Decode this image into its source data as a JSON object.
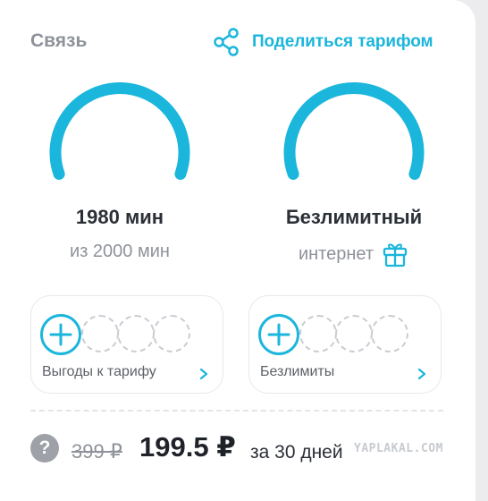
{
  "header": {
    "title": "Связь",
    "share_label": "Поделиться тарифом"
  },
  "gauges": [
    {
      "main": "1980 мин",
      "sub": "из 2000 мин",
      "remaining_fraction": 0.99
    },
    {
      "main": "Безлимитный",
      "sub": "интернет",
      "remaining_fraction": 1.0
    }
  ],
  "addons": [
    {
      "label": "Выгоды к тарифу",
      "empty_slots": 3
    },
    {
      "label": "Безлимиты",
      "empty_slots": 3
    }
  ],
  "price": {
    "old": "399 ₽",
    "new": "199.5 ₽",
    "period": "за 30 дней"
  },
  "watermark": "YAPLAKAL.COM",
  "colors": {
    "accent": "#1bb6dc",
    "muted_text": "#8e9299",
    "primary_text": "#2b2f36"
  },
  "icons": {
    "share": "share-icon",
    "gift": "gift-icon",
    "help": "question-icon",
    "add": "plus-icon",
    "chevron": "chevron-right-icon"
  }
}
